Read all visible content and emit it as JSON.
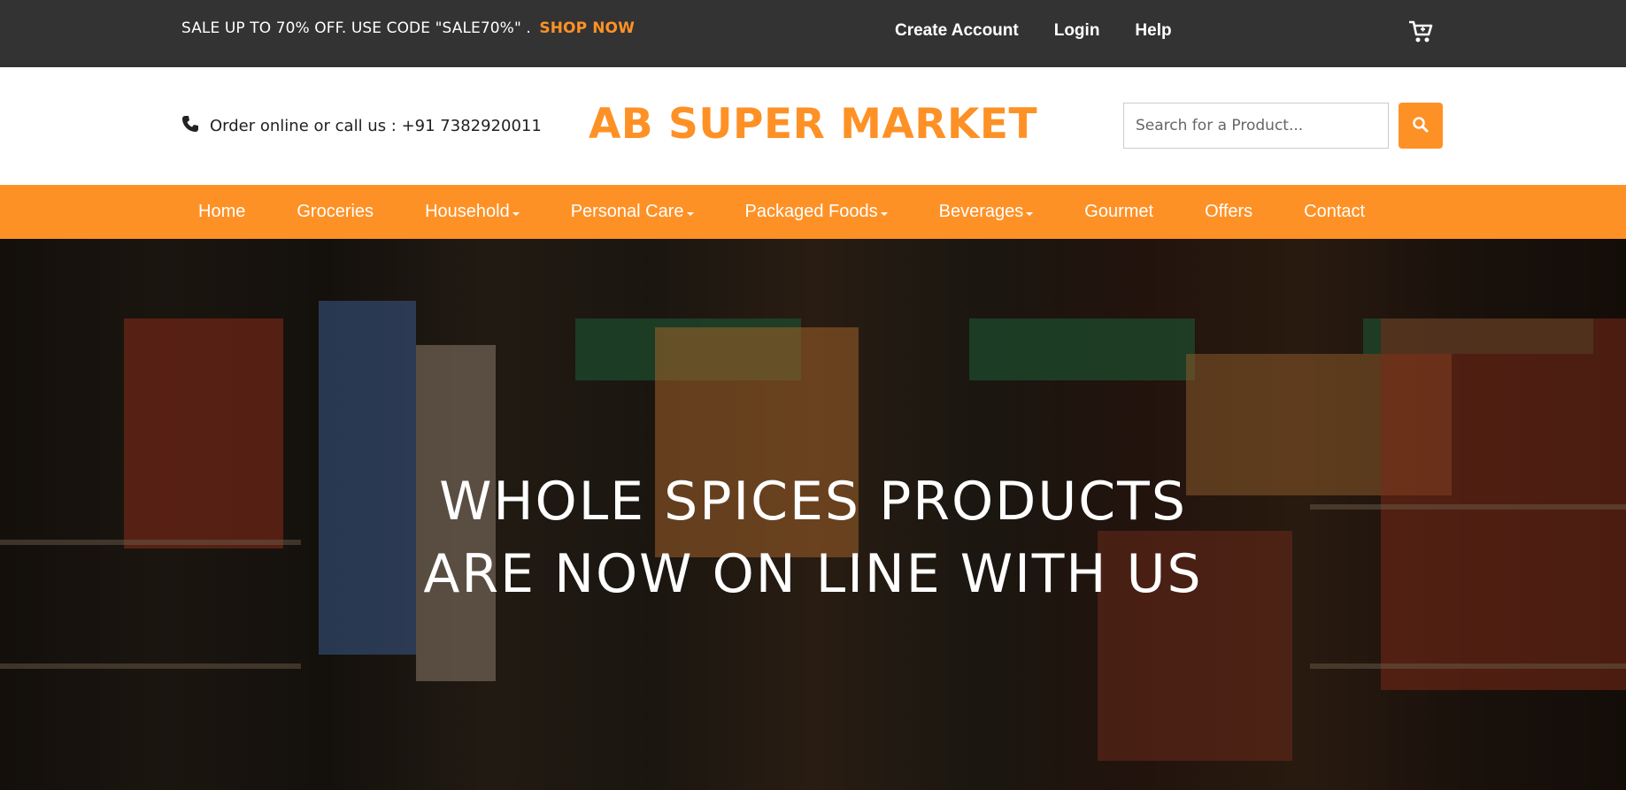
{
  "topbar": {
    "promo_text": "SALE UP TO 70% OFF. USE CODE \"SALE70%\" .",
    "promo_link": "SHOP NOW",
    "links": [
      "Create Account",
      "Login",
      "Help"
    ],
    "cart_icon": "cart-icon"
  },
  "header": {
    "phone_icon": "phone-icon",
    "contact_text": "Order online or call us : +91 7382920011",
    "brand": "AB SUPER MARKET",
    "search_placeholder": "Search for a Product...",
    "search_icon": "search-icon"
  },
  "nav": {
    "items": [
      {
        "label": "Home",
        "dropdown": false
      },
      {
        "label": "Groceries",
        "dropdown": false
      },
      {
        "label": "Household",
        "dropdown": true
      },
      {
        "label": "Personal Care",
        "dropdown": true
      },
      {
        "label": "Packaged Foods",
        "dropdown": true
      },
      {
        "label": "Beverages",
        "dropdown": true
      },
      {
        "label": "Gourmet",
        "dropdown": false
      },
      {
        "label": "Offers",
        "dropdown": false
      },
      {
        "label": "Contact",
        "dropdown": false
      }
    ]
  },
  "hero": {
    "line1": "WHOLE SPICES PRODUCTS",
    "line2": "ARE NOW ON LINE WITH US"
  },
  "colors": {
    "accent": "#fe9126",
    "topbar_bg": "#333333"
  }
}
